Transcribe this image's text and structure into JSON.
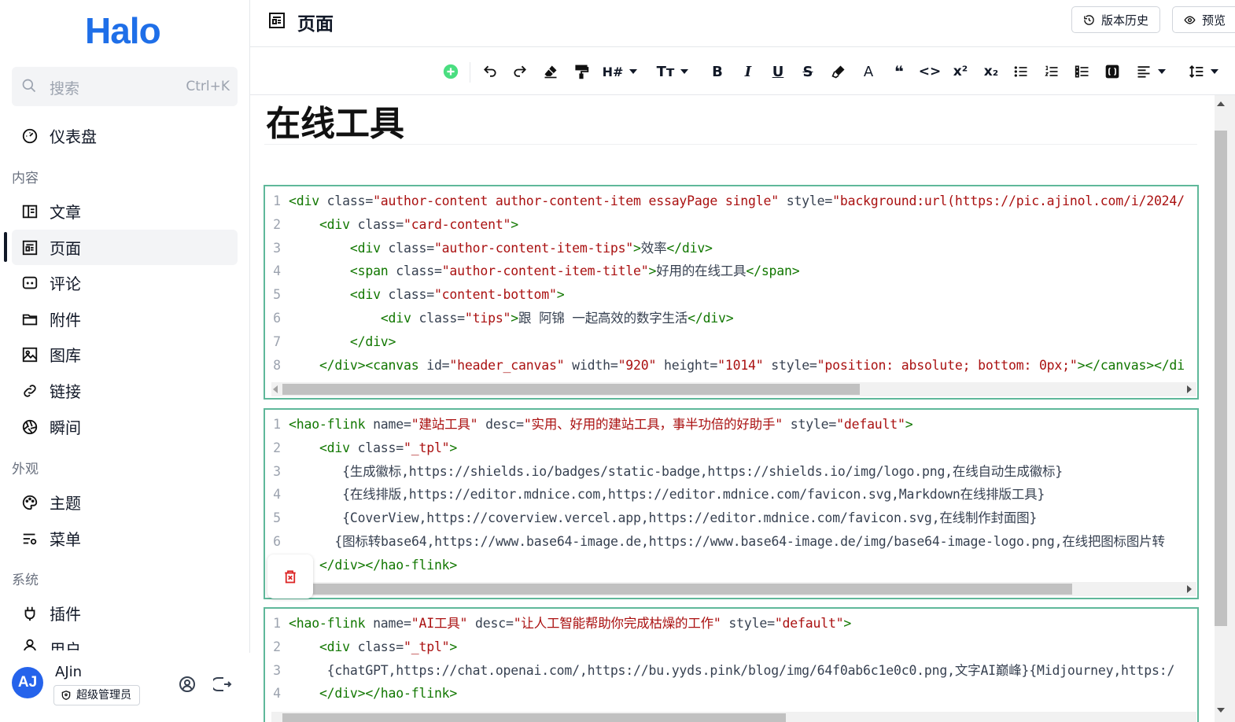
{
  "app": {
    "logo": "Halo"
  },
  "search": {
    "placeholder": "搜索",
    "shortcut": "Ctrl+K"
  },
  "sidebar": {
    "dashboard": "仪表盘",
    "groups": {
      "content": "内容",
      "appearance": "外观",
      "system": "系统"
    },
    "items": {
      "posts": "文章",
      "pages": "页面",
      "comments": "评论",
      "attachments": "附件",
      "gallery": "图库",
      "links": "链接",
      "moments": "瞬间",
      "themes": "主题",
      "menus": "菜单",
      "plugins": "插件",
      "users": "用户"
    }
  },
  "user": {
    "initials": "AJ",
    "name": "AJin",
    "role": "超级管理员"
  },
  "header": {
    "title": "页面",
    "history": "版本历史",
    "preview": "预览"
  },
  "toolbar": {
    "heading": "H#",
    "font_size": "Tт",
    "bold": "B",
    "italic": "I",
    "underline": "U",
    "strike": "S",
    "color": "A",
    "quote": "❝",
    "code": "<>",
    "sup": "x²",
    "sub": "x₂"
  },
  "document": {
    "title": "在线工具",
    "blocks": [
      {
        "lines": [
          {
            "n": "1",
            "html": "<span class='tag'>&lt;div</span> <span class='tk-attr'>class=</span><span class='tk-str'>\"author-content author-content-item essayPage single\"</span> <span class='tk-attr'>style=</span><span class='tk-str'>\"background:url(https://pic.ajinol.com/i/2024/</span>"
          },
          {
            "n": "2",
            "html": "    <span class='tag'>&lt;div</span> <span class='tk-attr'>class=</span><span class='tk-str'>\"card-content\"</span><span class='tag'>&gt;</span>"
          },
          {
            "n": "3",
            "html": "        <span class='tag'>&lt;div</span> <span class='tk-attr'>class=</span><span class='tk-str'>\"author-content-item-tips\"</span><span class='tag'>&gt;</span><span class='tk-txt'>效率</span><span class='tag'>&lt;/div&gt;</span>"
          },
          {
            "n": "4",
            "html": "        <span class='tag'>&lt;span</span> <span class='tk-attr'>class=</span><span class='tk-str'>\"author-content-item-title\"</span><span class='tag'>&gt;</span><span class='tk-txt'>好用的在线工具</span><span class='tag'>&lt;/span&gt;</span>"
          },
          {
            "n": "5",
            "html": "        <span class='tag'>&lt;div</span> <span class='tk-attr'>class=</span><span class='tk-str'>\"content-bottom\"</span><span class='tag'>&gt;</span>"
          },
          {
            "n": "6",
            "html": "            <span class='tag'>&lt;div</span> <span class='tk-attr'>class=</span><span class='tk-str'>\"tips\"</span><span class='tag'>&gt;</span><span class='tk-txt'>跟 阿锦 一起高效的数字生活</span><span class='tag'>&lt;/div&gt;</span>"
          },
          {
            "n": "7",
            "html": "        <span class='tag'>&lt;/div&gt;</span>"
          },
          {
            "n": "8",
            "html": "    <span class='tag'>&lt;/div&gt;&lt;canvas</span> <span class='tk-attr'>id=</span><span class='tk-str'>\"header_canvas\"</span> <span class='tk-attr'>width=</span><span class='tk-str'>\"920\"</span> <span class='tk-attr'>height=</span><span class='tk-str'>\"1014\"</span> <span class='tk-attr'>style=</span><span class='tk-str'>\"position: absolute; bottom: 0px;\"</span><span class='tag'>&gt;&lt;/canvas&gt;&lt;/di</span>"
          }
        ]
      },
      {
        "lines": [
          {
            "n": "1",
            "html": "<span class='tag'>&lt;hao-flink</span> <span class='tk-attr'>name=</span><span class='tk-str'>\"建站工具\"</span> <span class='tk-attr'>desc=</span><span class='tk-str'>\"实用、好用的建站工具，事半功倍的好助手\"</span> <span class='tk-attr'>style=</span><span class='tk-str'>\"default\"</span><span class='tag'>&gt;</span>"
          },
          {
            "n": "2",
            "html": "    <span class='tag'>&lt;div</span> <span class='tk-attr'>class=</span><span class='tk-str'>\"_tpl\"</span><span class='tag'>&gt;</span>"
          },
          {
            "n": "3",
            "html": "       <span class='tk-txt'>{生成徽标,https://shields.io/badges/static-badge,https://shields.io/img/logo.png,在线自动生成徽标}</span>"
          },
          {
            "n": "4",
            "html": "       <span class='tk-txt'>{在线排版,https://editor.mdnice.com,https://editor.mdnice.com/favicon.svg,Markdown在线排版工具}</span>"
          },
          {
            "n": "5",
            "html": "       <span class='tk-txt'>{CoverView,https://coverview.vercel.app,https://editor.mdnice.com/favicon.svg,在线制作封面图}</span>"
          },
          {
            "n": "6",
            "html": "      <span class='tk-txt'>{图标转base64,https://www.base64-image.de,https://www.base64-image.de/img/base64-image-logo.png,在线把图标图片转</span>"
          },
          {
            "n": "7",
            "html": "    <span class='tag'>&lt;/div&gt;&lt;/hao-flink&gt;</span>"
          }
        ]
      },
      {
        "lines": [
          {
            "n": "1",
            "html": "<span class='tag'>&lt;hao-flink</span> <span class='tk-attr'>name=</span><span class='tk-str'>\"AI工具\"</span> <span class='tk-attr'>desc=</span><span class='tk-str'>\"让人工智能帮助你完成枯燥的工作\"</span> <span class='tk-attr'>style=</span><span class='tk-str'>\"default\"</span><span class='tag'>&gt;</span>"
          },
          {
            "n": "2",
            "html": "    <span class='tag'>&lt;div</span> <span class='tk-attr'>class=</span><span class='tk-str'>\"_tpl\"</span><span class='tag'>&gt;</span>"
          },
          {
            "n": "3",
            "html": "     <span class='tk-txt'>{chatGPT,https://chat.openai.com/,https://bu.yyds.pink/blog/img/64f0ab6c1e0c0.png,文字AI巅峰}{Midjourney,https:/</span>"
          },
          {
            "n": "4",
            "html": "    <span class='tag'>&lt;/div&gt;&lt;/hao-flink&gt;</span>"
          }
        ]
      }
    ]
  },
  "colors": {
    "accent": "#1f6fe8",
    "code_border": "#5fb89a",
    "string": "#aa1111",
    "tag": "#117700",
    "add_button": "#4ade80",
    "delete": "#dc2626"
  }
}
